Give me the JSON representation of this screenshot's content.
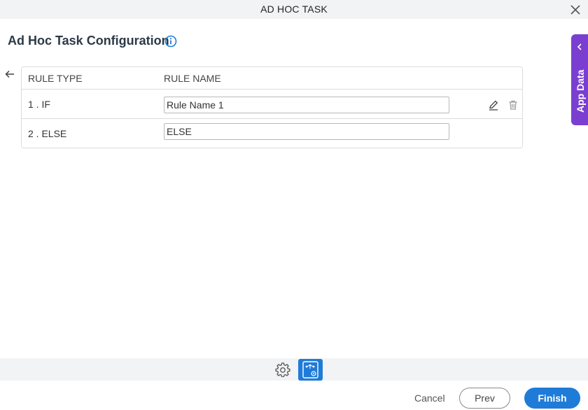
{
  "window": {
    "title": "AD HOC TASK"
  },
  "page": {
    "title": "Ad Hoc Task Configuration"
  },
  "table": {
    "headers": {
      "rule_type": "RULE TYPE",
      "rule_name": "RULE NAME"
    },
    "rows": [
      {
        "type": "1 . IF",
        "name": "Rule Name 1"
      },
      {
        "type": "2 . ELSE",
        "name": "ELSE"
      }
    ]
  },
  "side_panel": {
    "label": "App Data"
  },
  "footer": {
    "cancel": "Cancel",
    "prev": "Prev",
    "finish": "Finish"
  },
  "icons": {
    "close": "close-icon",
    "info": "info-icon",
    "back": "arrow-left-icon",
    "edit": "pencil-icon",
    "delete": "trash-icon",
    "chevron": "chevron-left-icon",
    "settings": "gear-icon",
    "process": "process-flow-icon"
  },
  "colors": {
    "accent": "#1f7bd8",
    "side_panel": "#7a3fd1",
    "toolbar_bg": "#f2f3f5"
  }
}
